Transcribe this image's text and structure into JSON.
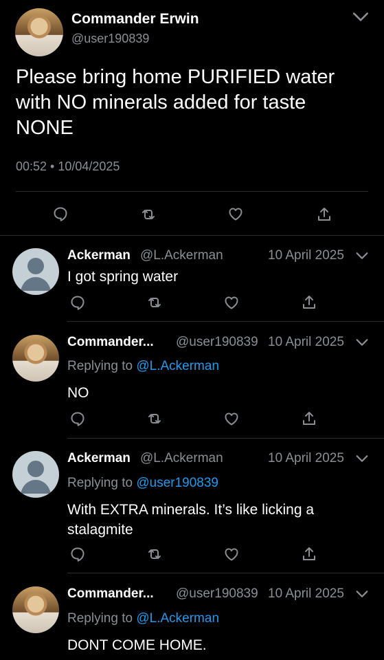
{
  "main_tweet": {
    "author": "Commander Erwin",
    "handle": "@user190839",
    "text": "Please bring home PURIFIED water with NO minerals added for taste NONE",
    "timestamp": "00:52 • 10/04/2025"
  },
  "replies": [
    {
      "name": "Ackerman",
      "handle": "@L.Ackerman",
      "date": "10 April 2025",
      "replying_to": "",
      "reply_prefix": "",
      "text": "I got spring water",
      "avatar": "default"
    },
    {
      "name": "Commander...",
      "handle": "@user190839",
      "date": "10 April 2025",
      "reply_prefix": "Replying to",
      "replying_to": "@L.Ackerman",
      "text": "NO",
      "avatar": "anime"
    },
    {
      "name": "Ackerman",
      "handle": "@L.Ackerman",
      "date": "10 April 2025",
      "reply_prefix": "Replying to",
      "replying_to": "@user190839",
      "text": "With EXTRA minerals. It’s like licking a stalagmite",
      "avatar": "default"
    },
    {
      "name": "Commander...",
      "handle": "@user190839",
      "date": "10 April 2025",
      "reply_prefix": "Replying to",
      "replying_to": "@L.Ackerman",
      "text": "DONT COME HOME.",
      "avatar": "anime"
    }
  ],
  "icons": [
    "reply-icon",
    "retweet-icon",
    "like-icon",
    "share-icon",
    "chevron-down-icon"
  ]
}
